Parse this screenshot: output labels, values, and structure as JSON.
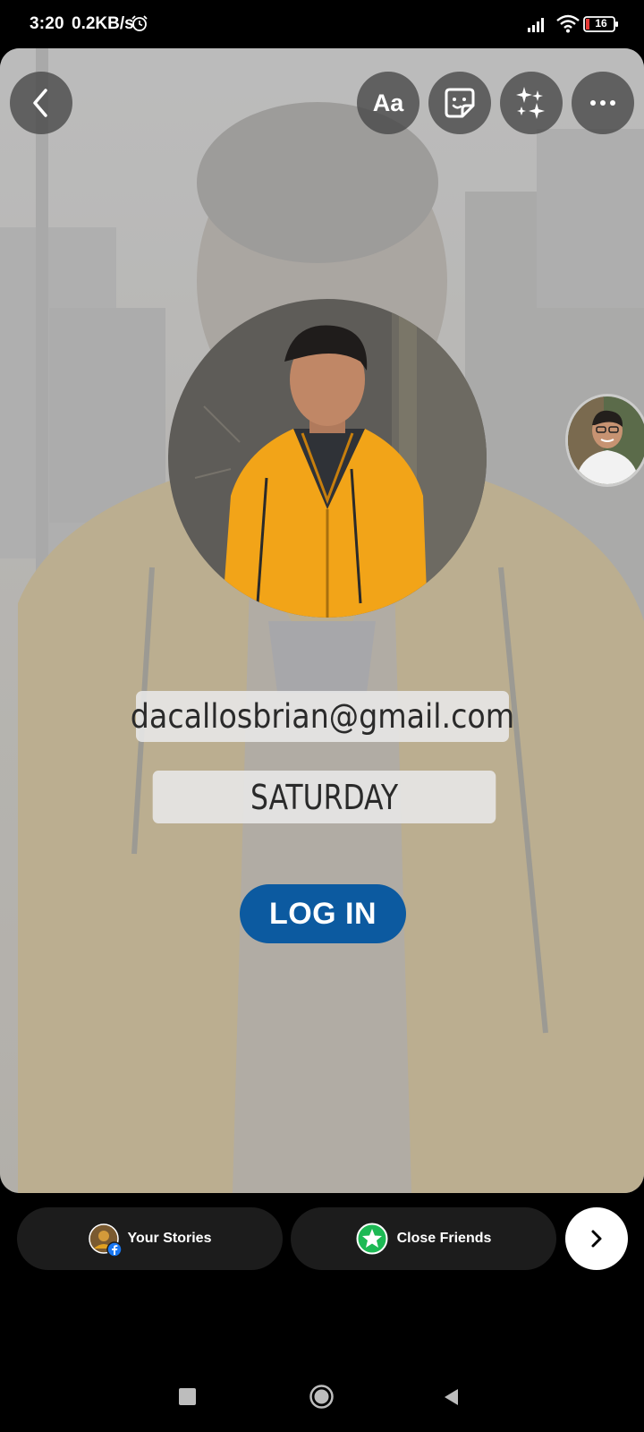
{
  "status_bar": {
    "time": "3:20",
    "net_speed": "0.2KB/s",
    "battery": "16",
    "icons": [
      "alarm-icon",
      "signal-icon",
      "wifi-icon",
      "battery-icon"
    ]
  },
  "editor_toolbar": {
    "back_icon": "chevron-left-icon",
    "text_tool_label": "Aa",
    "sticker_icon": "sticker-icon",
    "effects_icon": "sparkles-icon",
    "more_icon": "more-horizontal-icon"
  },
  "story": {
    "email_text": "dacallosbrian@gmail.com",
    "day_text": "SATURDAY",
    "login_label": "LOG IN",
    "colors": {
      "login_button": "#0c5aa0",
      "text_box_bg": "#e8e8e8",
      "text_color": "#2a2a2a",
      "hoodie": "#f2a418"
    }
  },
  "share_bar": {
    "your_stories_label": "Your Stories",
    "close_friends_label": "Close Friends",
    "next_icon": "chevron-right-icon",
    "close_friends_color": "#1db954"
  },
  "nav_bar": {
    "icons": [
      "recents-square-icon",
      "home-circle-icon",
      "back-triangle-icon"
    ]
  }
}
